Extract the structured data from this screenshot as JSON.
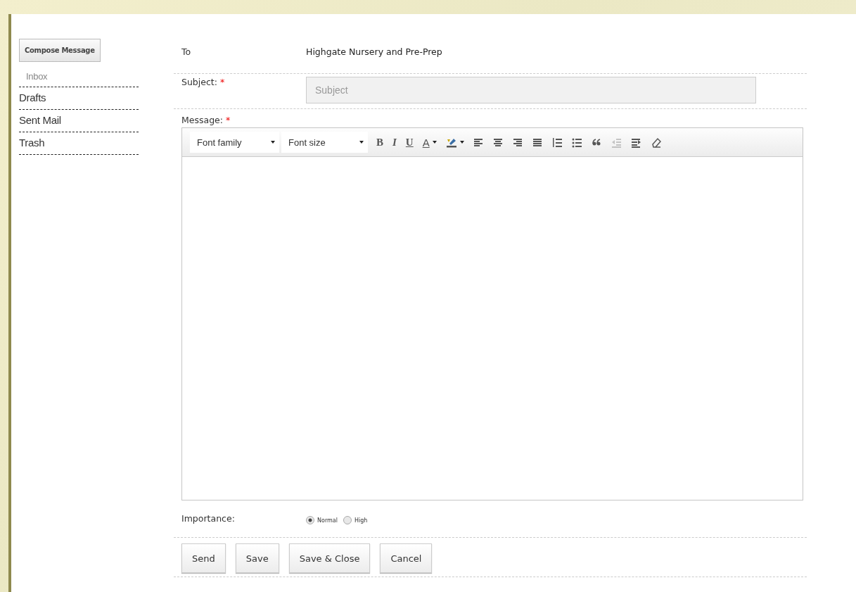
{
  "sidebar": {
    "compose_button": "Compose Message",
    "items": [
      {
        "label": "Inbox",
        "selected": true
      },
      {
        "label": "Drafts",
        "selected": false
      },
      {
        "label": "Sent Mail",
        "selected": false
      },
      {
        "label": "Trash",
        "selected": false
      }
    ]
  },
  "form": {
    "to": {
      "label": "To",
      "value": "Highgate Nursery and Pre-Prep"
    },
    "subject": {
      "label": "Subject:",
      "required_mark": "*",
      "placeholder": "Subject"
    },
    "message": {
      "label": "Message:",
      "required_mark": "*",
      "toolbar": {
        "font_family": "Font family",
        "font_size": "Font size",
        "buttons": [
          {
            "kind": "bold",
            "text": "B",
            "disabled": false
          },
          {
            "kind": "italic",
            "text": "I",
            "disabled": false
          },
          {
            "kind": "underline",
            "text": "U",
            "disabled": false
          },
          {
            "kind": "textcolor",
            "text": "A",
            "disabled": false
          },
          {
            "kind": "highlight",
            "disabled": false
          },
          {
            "kind": "alignleft",
            "disabled": false
          },
          {
            "kind": "aligncenter",
            "disabled": false
          },
          {
            "kind": "alignright",
            "disabled": false
          },
          {
            "kind": "justify",
            "disabled": false
          },
          {
            "kind": "numlist",
            "disabled": false
          },
          {
            "kind": "bullist",
            "disabled": false
          },
          {
            "kind": "quote",
            "disabled": false
          },
          {
            "kind": "outdent",
            "disabled": true
          },
          {
            "kind": "indent",
            "disabled": false
          },
          {
            "kind": "eraser",
            "disabled": false
          }
        ]
      }
    },
    "importance": {
      "label": "Importance:",
      "options": [
        {
          "label": "Normal",
          "selected": true
        },
        {
          "label": "High",
          "selected": false
        }
      ]
    },
    "buttons": [
      "Send",
      "Save",
      "Save & Close",
      "Cancel"
    ]
  }
}
